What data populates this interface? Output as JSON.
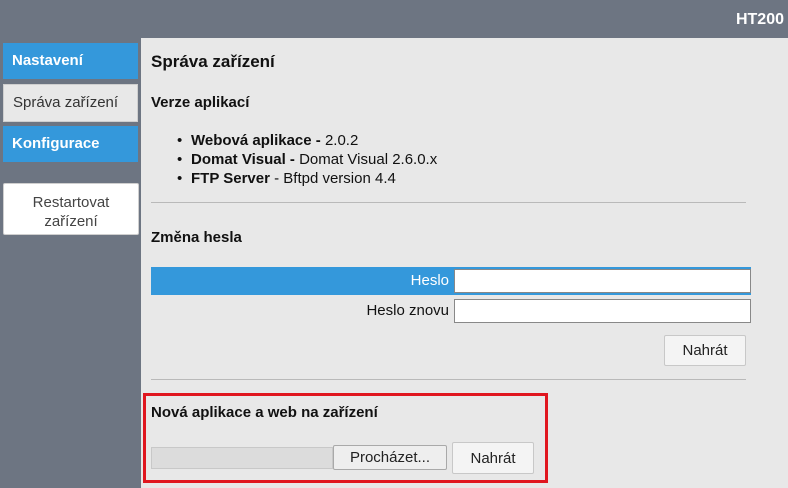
{
  "header": {
    "device": "HT200"
  },
  "sidebar": {
    "items": [
      {
        "label": "Nastavení"
      },
      {
        "label": "Správa zařízení"
      },
      {
        "label": "Konfigurace"
      }
    ],
    "restart_label": "Restartovat\nzařízení"
  },
  "main": {
    "title": "Správa zařízení",
    "versions": {
      "heading": "Verze aplikací",
      "items": [
        {
          "name": "Webová aplikace -",
          "value": " 2.0.2"
        },
        {
          "name": "Domat Visual -",
          "value": " Domat Visual 2.6.0.x"
        },
        {
          "name": "FTP Server",
          "value": " - Bftpd version 4.4"
        }
      ]
    },
    "password": {
      "heading": "Změna hesla",
      "field1_label": "Heslo",
      "field1_value": "",
      "field2_label": "Heslo znovu",
      "field2_value": "",
      "submit_label": "Nahrát"
    },
    "upload": {
      "heading": "Nová aplikace a web na zařízení",
      "file_value": "",
      "browse_label": "Procházet...",
      "submit_label": "Nahrát"
    }
  },
  "colors": {
    "accent": "#3498db",
    "highlight_border": "#e0161f",
    "sidebar_bg": "#6d7582",
    "content_bg": "#e8e8e8"
  }
}
